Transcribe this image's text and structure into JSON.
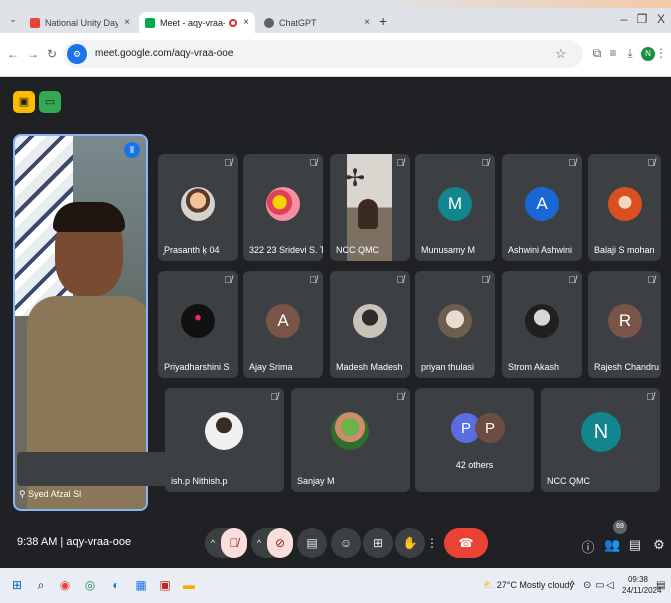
{
  "browser": {
    "tabs": [
      {
        "title": "National Unity Day - 2024 - ncc",
        "close": "×"
      },
      {
        "title": "Meet - aqy-vraa-ooe",
        "close": "×"
      },
      {
        "title": "ChatGPT",
        "close": "×"
      }
    ],
    "new_tab": "+",
    "window": {
      "minimize": "–",
      "maximize": "❐",
      "close": "X"
    },
    "url": "meet.google.com/aqy-vraa-ooe"
  },
  "meet": {
    "featured_name": "Syed Afzal Sl",
    "tiles_row1": [
      {
        "name": "̧Prasanth ķ 04"
      },
      {
        "name": "322 23 Sridevi S. T"
      },
      {
        "name": "NCC QMC"
      },
      {
        "name": "Munusamy M",
        "initial": "M",
        "color": "#12858f"
      },
      {
        "name": "Ashwini Ashwini",
        "initial": "A",
        "color": "#1967d2"
      },
      {
        "name": "Balaji S mohan"
      }
    ],
    "tiles_row2": [
      {
        "name": "Priyadharshini S"
      },
      {
        "name": "Ajay Srima",
        "initial": "A",
        "color": "#795548"
      },
      {
        "name": "Madesh Madesh"
      },
      {
        "name": "priyan thulasi"
      },
      {
        "name": "Strom Akash"
      },
      {
        "name": "Rajesh Chandru",
        "initial": "R",
        "color": "#795548"
      }
    ],
    "tiles_row3": [
      {
        "name": "ish.p Nithish.p"
      },
      {
        "name": "Sanjay M"
      },
      {
        "name": "42 others",
        "initials": [
          "P",
          "P"
        ],
        "colors": [
          "#5b6ee1",
          "#6d4c41"
        ]
      },
      {
        "name": "NCC QMC",
        "initial": "N",
        "color": "#12858f"
      }
    ],
    "time": "9:38 AM",
    "meeting_code": "aqy-vraa-ooe",
    "participant_count": "69"
  },
  "taskbar": {
    "temperature": "27°C",
    "weather": "Mostly cloudy",
    "time": "09:38",
    "date": "24/11/2024"
  }
}
